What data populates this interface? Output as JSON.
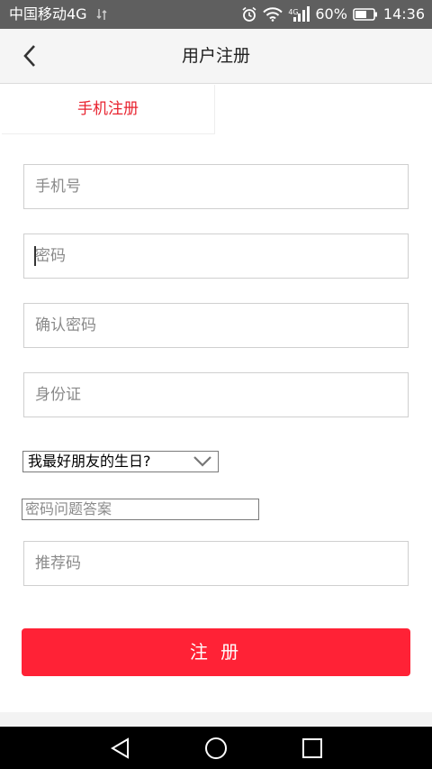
{
  "status_bar": {
    "carrier": "中国移动4G",
    "battery_percent": "60%",
    "time": "14:36",
    "network_tag": "4G"
  },
  "header": {
    "title": "用户注册"
  },
  "tab": {
    "label": "手机注册"
  },
  "form": {
    "phone_placeholder": "手机号",
    "password_placeholder": "密码",
    "confirm_password_placeholder": "确认密码",
    "id_card_placeholder": "身份证",
    "security_question_selected": "我最好朋友的生日?",
    "security_answer_placeholder": "密码问题答案",
    "referral_placeholder": "推荐码"
  },
  "submit_button": {
    "label": "注 册"
  },
  "colors": {
    "accent": "#ff2236",
    "tab_text": "#e8232f",
    "status_bar": "#5f5f5f",
    "nav_bar": "#000000"
  },
  "icons": [
    "back-arrow-icon",
    "alarm-icon",
    "wifi-icon",
    "signal-icon",
    "battery-icon",
    "chevron-down-icon",
    "nav-back-icon",
    "nav-home-icon",
    "nav-recents-icon"
  ]
}
